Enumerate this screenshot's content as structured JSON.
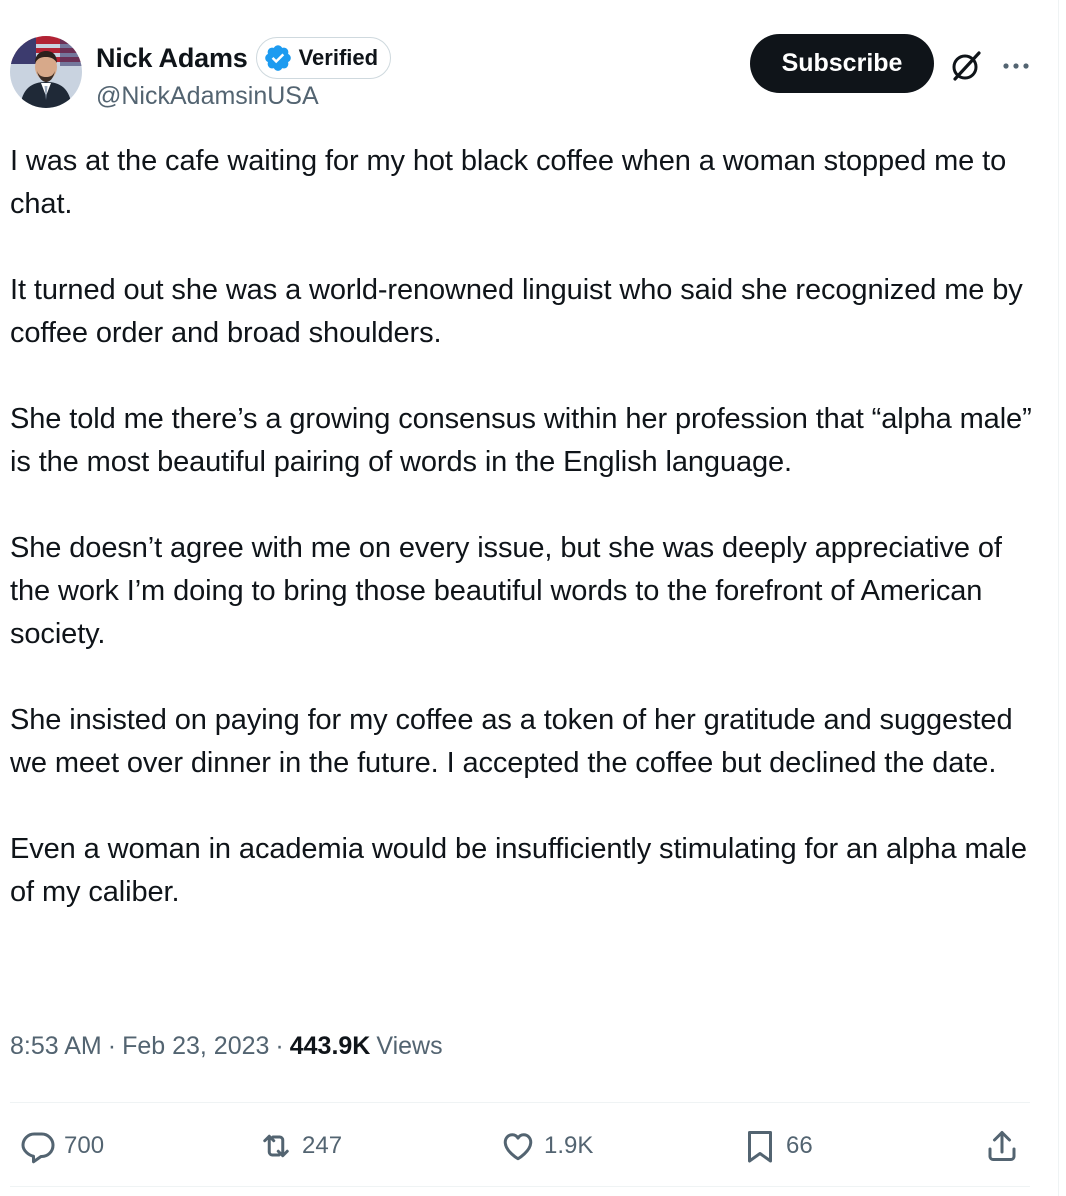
{
  "author": {
    "display_name": "Nick Adams",
    "verified_label": "Verified",
    "handle": "@NickAdamsinUSA"
  },
  "header": {
    "subscribe_label": "Subscribe",
    "grok_icon": "grok-icon",
    "more_icon": "more-options-icon"
  },
  "tweet": {
    "paragraphs": [
      "I was at the cafe waiting for my hot black coffee when a woman stopped me to chat.",
      "It turned out she was a world-renowned linguist who said she recognized me by coffee order and broad shoulders.",
      "She told me there’s a growing consensus within her profession that “alpha male” is the most beautiful pairing of words in the English language.",
      "She doesn’t agree with me on every issue, but she was deeply appreciative of the work I’m doing to bring those beautiful words to the forefront of American society.",
      "She insisted on paying for my coffee as a token of her gratitude and suggested we meet over dinner in the future. I accepted the coffee but declined the date.",
      "Even a woman in academia would be insufficiently stimulating for an alpha male of my caliber."
    ]
  },
  "meta": {
    "time": "8:53 AM",
    "separator": "·",
    "date": "Feb 23, 2023",
    "views_count": "443.9K",
    "views_label": "Views"
  },
  "actions": {
    "replies": "700",
    "reposts": "247",
    "likes": "1.9K",
    "bookmarks": "66"
  },
  "colors": {
    "verified_blue": "#1d9bf0",
    "text_primary": "#0f1419",
    "text_secondary": "#536471",
    "button_dark": "#0f1419"
  }
}
